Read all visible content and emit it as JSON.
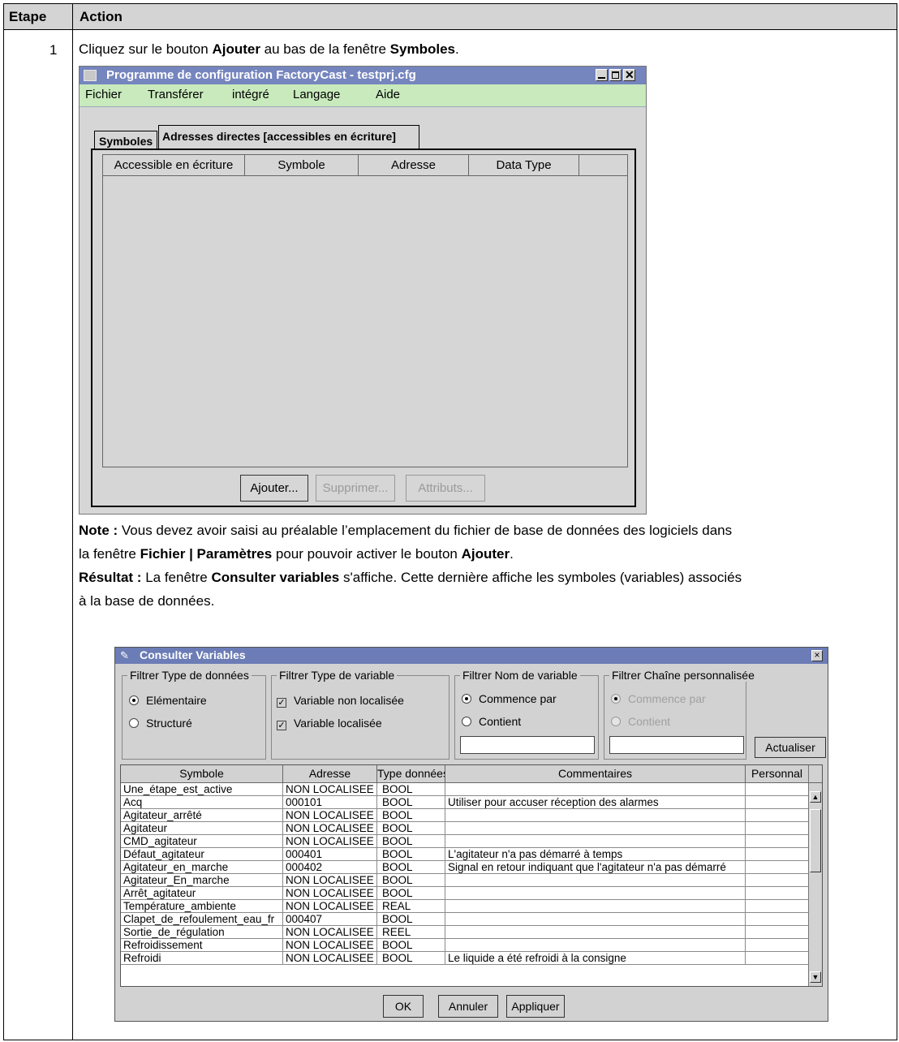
{
  "doc": {
    "col_etape": "Etape",
    "col_action": "Action",
    "step_number": "1",
    "instruction": {
      "pre": "Cliquez sur le bouton ",
      "bold1": "Ajouter",
      "mid": " au bas de la fenêtre ",
      "bold2": "Symboles",
      "post": "."
    },
    "note": {
      "label": "Note :",
      "line1": " Vous devez avoir saisi au préalable l’emplacement du fichier de base de données des logiciels dans",
      "line2_pre": "la fenêtre ",
      "line2_bold1": "Fichier | Paramètres",
      "line2_mid": " pour pouvoir activer le bouton ",
      "line2_bold2": "Ajouter",
      "line2_post": "."
    },
    "result": {
      "label": "Résultat :",
      "line1_pre": " La fenêtre ",
      "line1_bold": "Consulter variables",
      "line1_post": " s'affiche. Cette dernière affiche les symboles (variables) associés",
      "line2": "à la base de données."
    }
  },
  "factorycast": {
    "title": "Programme de configuration FactoryCast  - testprj.cfg",
    "menu": [
      "Fichier",
      "Transférer",
      "intégré",
      "Langage",
      "Aide"
    ],
    "tabs": [
      "Symboles",
      "Adresses directes [accessibles en écriture]"
    ],
    "columns": [
      "Accessible en écriture",
      "Symbole",
      "Adresse",
      "Data Type"
    ],
    "buttons": [
      "Ajouter...",
      "Supprimer...",
      "Attributs..."
    ]
  },
  "consulter": {
    "title": "Consulter Variables",
    "close_label": "×",
    "group_type_donnees": {
      "label": "Filtrer Type de données",
      "options": [
        "Elémentaire",
        "Structuré"
      ]
    },
    "group_type_variable": {
      "label": "Filtrer Type de variable",
      "options": [
        "Variable non localisée",
        "Variable localisée"
      ]
    },
    "group_nom_variable": {
      "label": "Filtrer Nom de variable",
      "options": [
        "Commence par",
        "Contient"
      ],
      "field_value": ""
    },
    "group_chaine": {
      "label": "Filtrer Chaîne personnalisée",
      "options": [
        "Commence par",
        "Contient"
      ],
      "field_value": ""
    },
    "refresh_button": "Actualiser",
    "columns": [
      "Symbole",
      "Adresse",
      "Type données",
      "Commentaires",
      "Personnal"
    ],
    "rows": [
      {
        "symbole": "Une_étape_est_active",
        "adresse": "NON LOCALISEE",
        "type": "BOOL",
        "commentaire": ""
      },
      {
        "symbole": "Acq",
        "adresse": "000101",
        "type": "BOOL",
        "commentaire": "Utiliser pour accuser réception des alarmes"
      },
      {
        "symbole": "Agitateur_arrêté",
        "adresse": "NON LOCALISEE",
        "type": "BOOL",
        "commentaire": ""
      },
      {
        "symbole": "Agitateur",
        "adresse": "NON LOCALISEE",
        "type": "BOOL",
        "commentaire": ""
      },
      {
        "symbole": "CMD_agitateur",
        "adresse": "NON LOCALISEE",
        "type": "BOOL",
        "commentaire": ""
      },
      {
        "symbole": "Défaut_agitateur",
        "adresse": "000401",
        "type": "BOOL",
        "commentaire": "L'agitateur n'a pas démarré à temps"
      },
      {
        "symbole": "Agitateur_en_marche",
        "adresse": "000402",
        "type": "BOOL",
        "commentaire": "Signal en retour indiquant que l'agitateur n'a pas démarré"
      },
      {
        "symbole": "Agitateur_En_marche",
        "adresse": "NON LOCALISEE",
        "type": "BOOL",
        "commentaire": ""
      },
      {
        "symbole": "Arrêt_agitateur",
        "adresse": "NON LOCALISEE",
        "type": "BOOL",
        "commentaire": ""
      },
      {
        "symbole": "Température_ambiente",
        "adresse": "NON LOCALISEE",
        "type": "REAL",
        "commentaire": ""
      },
      {
        "symbole": "Clapet_de_refoulement_eau_fr",
        "adresse": "000407",
        "type": "BOOL",
        "commentaire": ""
      },
      {
        "symbole": "Sortie_de_régulation",
        "adresse": "NON LOCALISEE",
        "type": "REEL",
        "commentaire": ""
      },
      {
        "symbole": "Refroidissement",
        "adresse": "NON LOCALISEE",
        "type": "BOOL",
        "commentaire": ""
      },
      {
        "symbole": "Refroidi",
        "adresse": "NON LOCALISEE",
        "type": "BOOL",
        "commentaire": "Le liquide a été refroidi à la consigne"
      }
    ],
    "buttons": [
      "OK",
      "Annuler",
      "Appliquer"
    ]
  }
}
